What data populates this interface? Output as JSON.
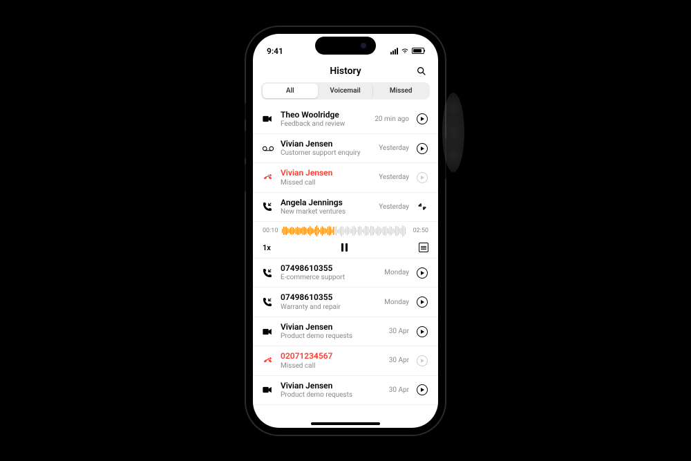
{
  "status": {
    "time": "9:41"
  },
  "header": {
    "title": "History"
  },
  "tabs": {
    "all": "All",
    "voicemail": "Voicemail",
    "missed": "Missed"
  },
  "player": {
    "elapsed": "00:10",
    "total": "02:50",
    "speed": "1x"
  },
  "rows": [
    {
      "name": "Theo Woolridge",
      "sub": "Feedback and review",
      "time": "20 min ago",
      "icon": "video",
      "missed": false,
      "action": "play"
    },
    {
      "name": "Vivian Jensen",
      "sub": "Customer support enquiry",
      "time": "Yesterday",
      "icon": "voicemail",
      "missed": false,
      "action": "play"
    },
    {
      "name": "Vivian Jensen",
      "sub": "Missed call",
      "time": "Yesterday",
      "icon": "missed",
      "missed": true,
      "action": "play-dim"
    },
    {
      "name": "Angela Jennings",
      "sub": "New market ventures",
      "time": "Yesterday",
      "icon": "incoming",
      "missed": false,
      "action": "collapse",
      "expanded": true
    },
    {
      "name": "07498610355",
      "sub": "E-commerce support",
      "time": "Monday",
      "icon": "incoming",
      "missed": false,
      "action": "play"
    },
    {
      "name": "07498610355",
      "sub": "Warranty and repair",
      "time": "Monday",
      "icon": "incoming",
      "missed": false,
      "action": "play"
    },
    {
      "name": "Vivian Jensen",
      "sub": "Product demo requests",
      "time": "30 Apr",
      "icon": "video",
      "missed": false,
      "action": "play"
    },
    {
      "name": "02071234567",
      "sub": "Missed call",
      "time": "30 Apr",
      "icon": "missed",
      "missed": true,
      "action": "play-dim"
    },
    {
      "name": "Vivian Jensen",
      "sub": "Product demo requests",
      "time": "30 Apr",
      "icon": "video",
      "missed": false,
      "action": "play"
    }
  ]
}
